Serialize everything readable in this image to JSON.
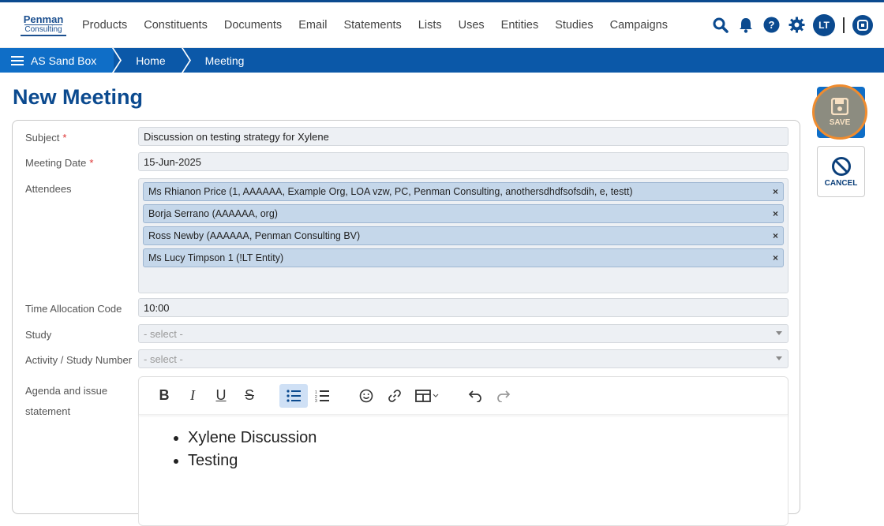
{
  "logo": {
    "line1": "Penman",
    "line2": "Consulting"
  },
  "nav": [
    "Products",
    "Constituents",
    "Documents",
    "Email",
    "Statements",
    "Lists",
    "Uses",
    "Entities",
    "Studies",
    "Campaigns"
  ],
  "user": {
    "initials": "LT"
  },
  "breadcrumb": {
    "root": "AS Sand Box",
    "home": "Home",
    "current": "Meeting"
  },
  "page": {
    "title": "New Meeting"
  },
  "form": {
    "subject_label": "Subject",
    "subject_value": "Discussion on testing strategy for Xylene",
    "date_label": "Meeting Date",
    "date_value": "15-Jun-2025",
    "attendees_label": "Attendees",
    "attendees": [
      "Ms Rhianon Price (1, AAAAAA, Example Org, LOA vzw, PC, Penman Consulting, anothersdhdfsofsdih, e, testt)",
      "Borja Serrano (AAAAAA, org)",
      "Ross Newby (AAAAAA, Penman Consulting BV)",
      "Ms Lucy Timpson 1 (!LT Entity)"
    ],
    "remove_glyph": "×",
    "required_mark": "*",
    "tac_label": "Time Allocation Code",
    "tac_value": "10:00",
    "study_label": "Study",
    "study_placeholder": "- select -",
    "activity_label": "Activity / Study Number",
    "activity_placeholder": "- select -",
    "agenda_label_1": "Agenda and issue",
    "agenda_label_2": "statement",
    "agenda_items": [
      "Xylene Discussion",
      "Testing"
    ]
  },
  "actions": {
    "save": "SAVE",
    "cancel": "CANCEL"
  },
  "colors": {
    "brand": "#0b4a8f",
    "crumb": "#0b58a8",
    "accent_ring": "#f08c2e"
  }
}
